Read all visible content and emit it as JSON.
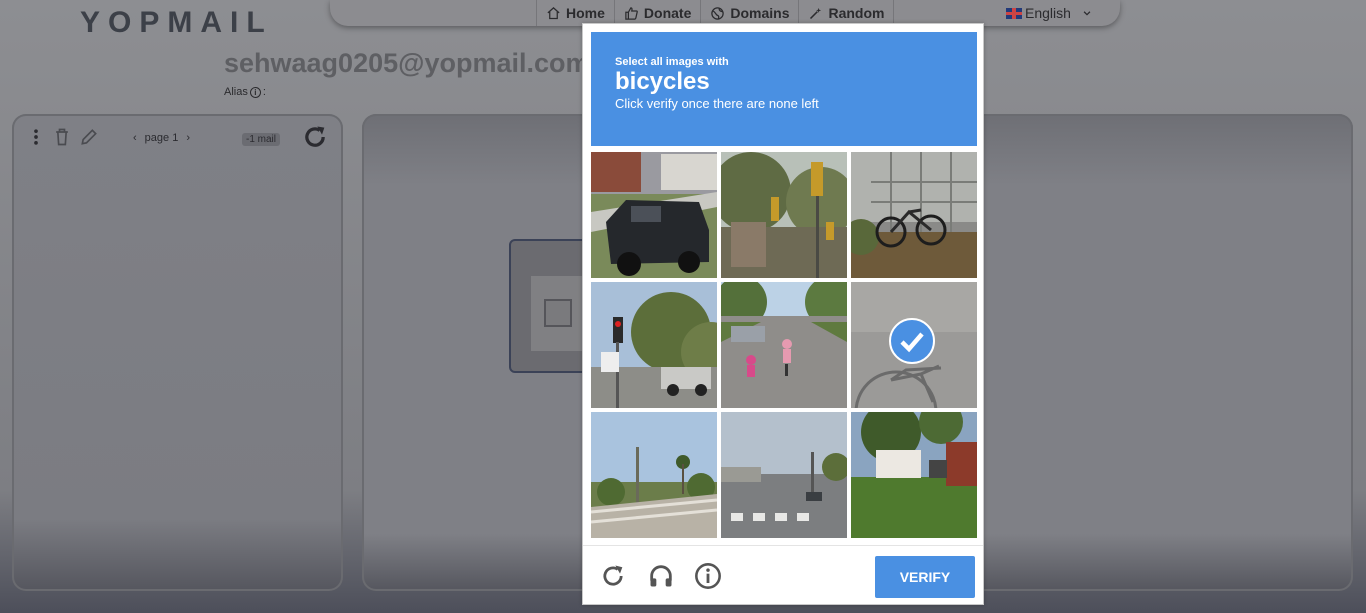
{
  "header": {
    "logo": "YOPMAIL",
    "nav": [
      {
        "label": "Home",
        "icon": "home-icon"
      },
      {
        "label": "Donate",
        "icon": "thumbs-up-icon"
      },
      {
        "label": "Domains",
        "icon": "globe-icon"
      },
      {
        "label": "Random",
        "icon": "magic-wand-icon"
      }
    ],
    "language": "English"
  },
  "inbox": {
    "email": "sehwaag0205@yopmail.com",
    "alias_label": "Alias",
    "alias_suffix": ":",
    "page_label": "page 1",
    "mail_count": "-1 mail"
  },
  "captcha": {
    "instruction": "Select all images with",
    "target": "bicycles",
    "hint": "Click verify once there are none left",
    "tiles": [
      {
        "scene": "suv",
        "selected": false
      },
      {
        "scene": "traffic-lights-trees",
        "selected": false
      },
      {
        "scene": "bicycles-fence",
        "selected": false
      },
      {
        "scene": "traffic-light-truck",
        "selected": false
      },
      {
        "scene": "cyclists-road",
        "selected": false
      },
      {
        "scene": "bicycle-closeup",
        "selected": true
      },
      {
        "scene": "palm-trees-fence",
        "selected": false
      },
      {
        "scene": "crosswalk-intersection",
        "selected": false
      },
      {
        "scene": "house-lawn",
        "selected": false
      }
    ],
    "verify_label": "VERIFY",
    "colors": {
      "accent": "#4a90e2"
    }
  }
}
